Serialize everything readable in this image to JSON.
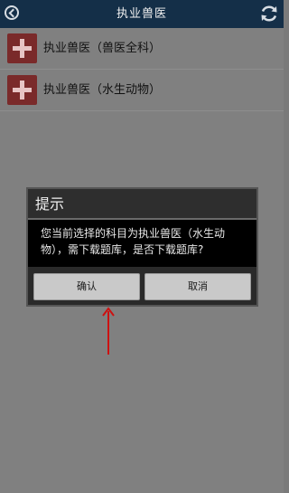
{
  "header": {
    "title": "执业兽医"
  },
  "list": {
    "items": [
      {
        "label": "执业兽医（兽医全科）"
      },
      {
        "label": "执业兽医（水生动物）"
      }
    ]
  },
  "dialog": {
    "title": "提示",
    "message": "您当前选择的科目为执业兽医（水生动物），需下载题库，是否下载题库?",
    "confirm_label": "确认",
    "cancel_label": "取消"
  },
  "colors": {
    "topbar": "#142f48",
    "accent_red": "#7a2a2a",
    "annotation_arrow": "#cc1111"
  },
  "icons": {
    "back": "back-circle-icon",
    "refresh": "refresh-icon",
    "add": "plus-icon"
  }
}
